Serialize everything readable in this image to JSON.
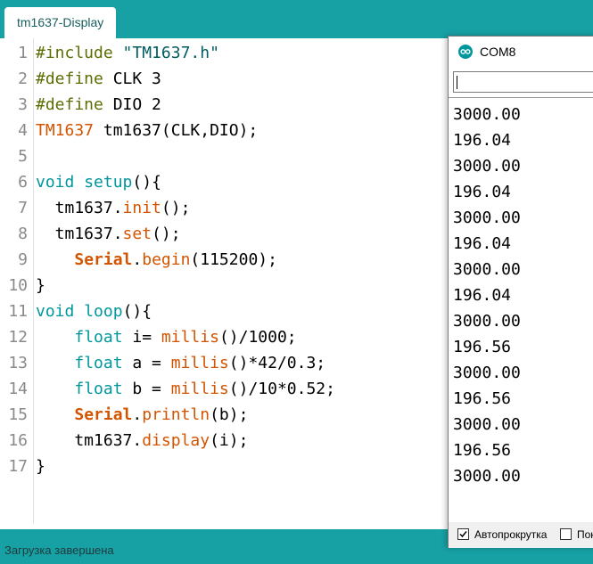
{
  "tab": {
    "label": "tm1637-Display"
  },
  "code_lines": [
    {
      "num": "1",
      "tokens": [
        {
          "t": "#include ",
          "c": "pp"
        },
        {
          "t": "\"TM1637.h\"",
          "c": "str"
        }
      ]
    },
    {
      "num": "2",
      "tokens": [
        {
          "t": "#define",
          "c": "pp"
        },
        {
          "t": " CLK 3",
          "c": ""
        }
      ]
    },
    {
      "num": "3",
      "tokens": [
        {
          "t": "#define",
          "c": "pp"
        },
        {
          "t": " DIO 2",
          "c": ""
        }
      ]
    },
    {
      "num": "4",
      "tokens": [
        {
          "t": "TM1637",
          "c": "fn"
        },
        {
          "t": " tm1637(CLK,DIO);",
          "c": ""
        }
      ]
    },
    {
      "num": "5",
      "tokens": []
    },
    {
      "num": "6",
      "tokens": [
        {
          "t": "void",
          "c": "kw"
        },
        {
          "t": " ",
          "c": ""
        },
        {
          "t": "setup",
          "c": "kw"
        },
        {
          "t": "(){",
          "c": ""
        }
      ]
    },
    {
      "num": "7",
      "tokens": [
        {
          "t": "  tm1637.",
          "c": ""
        },
        {
          "t": "init",
          "c": "fn"
        },
        {
          "t": "();",
          "c": ""
        }
      ]
    },
    {
      "num": "8",
      "tokens": [
        {
          "t": "  tm1637.",
          "c": ""
        },
        {
          "t": "set",
          "c": "fn"
        },
        {
          "t": "();",
          "c": ""
        }
      ]
    },
    {
      "num": "9",
      "tokens": [
        {
          "t": "    ",
          "c": ""
        },
        {
          "t": "Serial",
          "c": "obj"
        },
        {
          "t": ".",
          "c": ""
        },
        {
          "t": "begin",
          "c": "fn"
        },
        {
          "t": "(115200);",
          "c": ""
        }
      ]
    },
    {
      "num": "10",
      "tokens": [
        {
          "t": "}",
          "c": ""
        }
      ]
    },
    {
      "num": "11",
      "tokens": [
        {
          "t": "void",
          "c": "kw"
        },
        {
          "t": " ",
          "c": ""
        },
        {
          "t": "loop",
          "c": "kw"
        },
        {
          "t": "(){",
          "c": ""
        }
      ]
    },
    {
      "num": "12",
      "tokens": [
        {
          "t": "    ",
          "c": ""
        },
        {
          "t": "float",
          "c": "kw"
        },
        {
          "t": " i= ",
          "c": ""
        },
        {
          "t": "millis",
          "c": "fn"
        },
        {
          "t": "()/1000;",
          "c": ""
        }
      ]
    },
    {
      "num": "13",
      "tokens": [
        {
          "t": "    ",
          "c": ""
        },
        {
          "t": "float",
          "c": "kw"
        },
        {
          "t": " a = ",
          "c": ""
        },
        {
          "t": "millis",
          "c": "fn"
        },
        {
          "t": "()*42/0.3;",
          "c": ""
        }
      ]
    },
    {
      "num": "14",
      "tokens": [
        {
          "t": "    ",
          "c": ""
        },
        {
          "t": "float",
          "c": "kw"
        },
        {
          "t": " b = ",
          "c": ""
        },
        {
          "t": "millis",
          "c": "fn"
        },
        {
          "t": "()/10*0.52;",
          "c": ""
        }
      ]
    },
    {
      "num": "15",
      "tokens": [
        {
          "t": "    ",
          "c": ""
        },
        {
          "t": "Serial",
          "c": "obj"
        },
        {
          "t": ".",
          "c": ""
        },
        {
          "t": "println",
          "c": "fn"
        },
        {
          "t": "(b);",
          "c": ""
        }
      ]
    },
    {
      "num": "16",
      "tokens": [
        {
          "t": "    tm1637.",
          "c": ""
        },
        {
          "t": "display",
          "c": "fn"
        },
        {
          "t": "(i);",
          "c": ""
        }
      ]
    },
    {
      "num": "17",
      "tokens": [
        {
          "t": "}",
          "c": ""
        }
      ]
    }
  ],
  "serial_monitor": {
    "title": "COM8",
    "icon": "arduino-icon",
    "input_value": "",
    "output": [
      "3000.00",
      "196.04",
      "3000.00",
      "196.04",
      "3000.00",
      "196.04",
      "3000.00",
      "196.04",
      "3000.00",
      "196.56",
      "3000.00",
      "196.56",
      "3000.00",
      "196.56",
      "3000.00"
    ],
    "autoscroll_label": "Автопрокрутка",
    "autoscroll_checked": true,
    "show_timestamp_label": "Пок",
    "show_timestamp_checked": false
  },
  "status": {
    "text": "Загрузка завершена"
  },
  "colors": {
    "toolbar_teal": "#17a1a5",
    "keyword": "#00979c",
    "function": "#d35400",
    "preprocessor": "#5e6d03",
    "string": "#005c5f"
  }
}
